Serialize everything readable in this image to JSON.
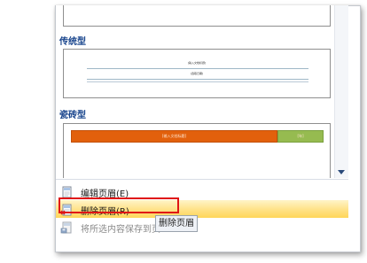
{
  "gallery": {
    "sections": [
      {
        "label": "传统型",
        "captions": [
          "[输入文档标题]",
          "[选取日期]"
        ]
      },
      {
        "label": "瓷砖型",
        "captions": [
          "[输入文档标题]",
          "[年]"
        ]
      }
    ]
  },
  "menu": {
    "items": [
      {
        "label": "编辑页眉(E)",
        "state": "normal"
      },
      {
        "label": "删除页眉(R)",
        "state": "highlighted"
      },
      {
        "label": "将所选内容保存到页",
        "state": "disabled"
      }
    ],
    "tooltip": "删除页眉"
  },
  "colors": {
    "accent_orange": "#e2600c",
    "accent_green": "#96bb50",
    "highlight": "#ffd659",
    "outline_red": "#e01515",
    "section_label": "#15428b"
  },
  "icons": [
    "page-icon",
    "page-delete-icon",
    "save-page-icon",
    "scroll-down-arrow-icon"
  ]
}
